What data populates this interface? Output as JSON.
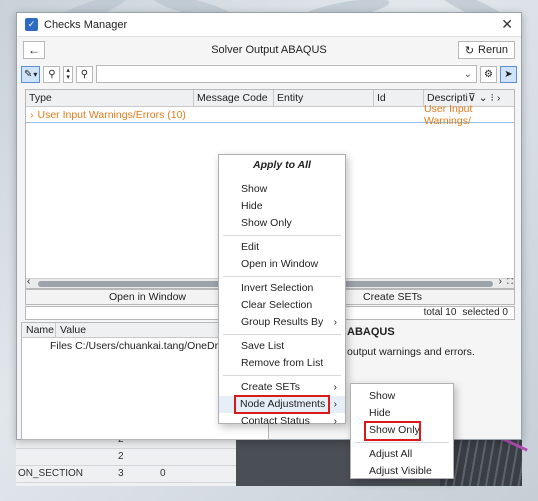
{
  "window": {
    "title": "Checks Manager",
    "close_glyph": "✕"
  },
  "header": {
    "title": "Solver Output ABAQUS",
    "rerun_label": "Rerun"
  },
  "table": {
    "columns": [
      "Type",
      "Message Code",
      "Entity",
      "Id",
      "Descripti"
    ],
    "group_label": "User Input Warnings/Errors (10)",
    "group_right": "User Input Warnings/"
  },
  "actions": {
    "open_in_window": "Open in Window",
    "create_sets": "Create SETs"
  },
  "status": {
    "total": "total 10",
    "selected": "selected 0"
  },
  "props": {
    "columns": [
      "Name",
      "Value"
    ],
    "rows": [
      {
        "label": "Files",
        "value": "C:/Users/chuankai.tang/OneDrive - C"
      }
    ]
  },
  "detail": {
    "title": "ABAQUS",
    "description": "output warnings and errors."
  },
  "context_menu": {
    "header": "Apply to All",
    "items": {
      "show": "Show",
      "hide": "Hide",
      "show_only": "Show Only",
      "edit": "Edit",
      "open_in_window": "Open in Window",
      "invert_selection": "Invert Selection",
      "clear_selection": "Clear Selection",
      "group_results_by": "Group Results By",
      "save_list": "Save List",
      "remove_from_list": "Remove from List",
      "create_sets": "Create SETs",
      "node_adjustments": "Node Adjustments",
      "contact_status": "Contact Status"
    }
  },
  "submenu": {
    "show": "Show",
    "hide": "Hide",
    "show_only": "Show Only",
    "adjust_all": "Adjust All",
    "adjust_visible": "Adjust Visible"
  },
  "background_table": {
    "rows": [
      {
        "name": "",
        "a": "2",
        "b": ""
      },
      {
        "name": "",
        "a": "2",
        "b": ""
      },
      {
        "name": "ON_SECTION",
        "a": "3",
        "b": "0"
      }
    ]
  },
  "colors": {
    "accent": "#2d6cc0",
    "warning_text": "#e07b1a",
    "highlight_box": "#d91a1a"
  }
}
